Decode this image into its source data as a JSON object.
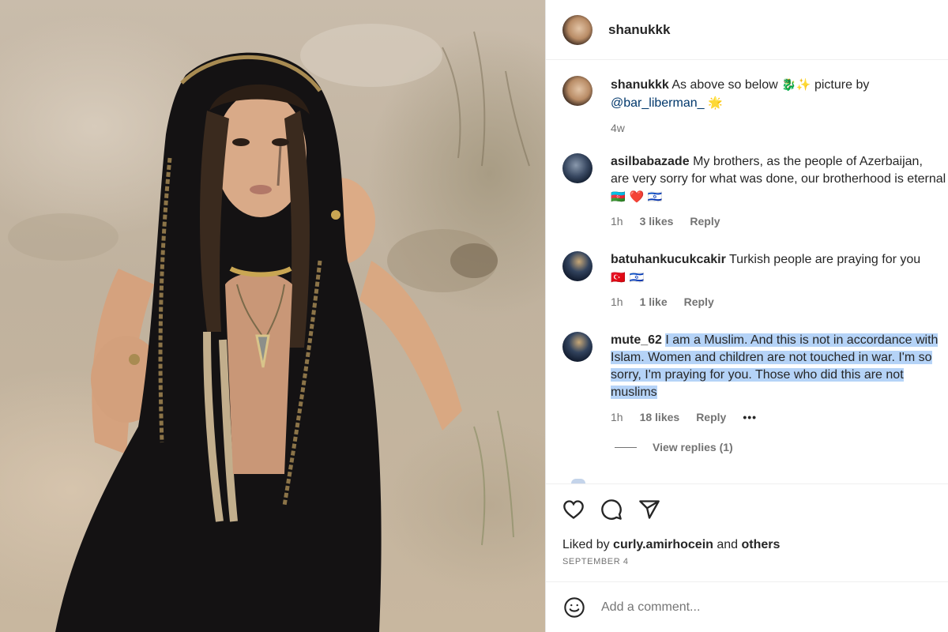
{
  "post": {
    "author": "shanukkk",
    "photo_alt": "Photo shared by shanukkk",
    "caption": {
      "username": "shanukkk",
      "text_before": "As above so below",
      "emoji_1": "🐉",
      "emoji_2": "✨",
      "text_after": "picture by",
      "mention": "@bar_liberman_",
      "emoji_3": "🌟",
      "time": "4w"
    }
  },
  "comments": [
    {
      "username": "asilbabazade",
      "text_line1": "My brothers, as the people of Azerbaijan,",
      "text_line2": "are very sorry for what was done, our brotherhood is eternal",
      "emojis": "🇦🇿 ❤️ 🇮🇱",
      "time": "1h",
      "likes": "3 likes",
      "reply": "Reply"
    },
    {
      "username": "batuhankucukcakir",
      "text_line1": "Turkish people are praying for you",
      "emojis": "🇹🇷 🇮🇱",
      "time": "1h",
      "likes": "1 like",
      "reply": "Reply"
    },
    {
      "username": "mute_62",
      "text_line1": "I am a Muslim. And this is not in accordance with",
      "text_line2": "Islam. Women and children are not touched in war. I'm so",
      "text_line3": "sorry, I'm praying for you. Those who did this are not",
      "text_line4": "muslims",
      "time": "1h",
      "likes": "18 likes",
      "reply": "Reply",
      "more": "•••"
    }
  ],
  "view_replies": "View replies (1)",
  "liked_by": {
    "prefix": "Liked by",
    "user": "curly.amirhocein",
    "conj": "and",
    "others": "others"
  },
  "date": "SEPTEMBER 4",
  "add_comment": {
    "placeholder": "Add a comment..."
  },
  "icons": {
    "like": "heart-icon",
    "comment": "comment-bubble-icon",
    "share": "paper-plane-icon",
    "emoji": "smiley-icon"
  },
  "colors": {
    "highlight": "#b5d3f7",
    "mention": "#00376b",
    "muted": "#737373",
    "text": "#262626"
  }
}
